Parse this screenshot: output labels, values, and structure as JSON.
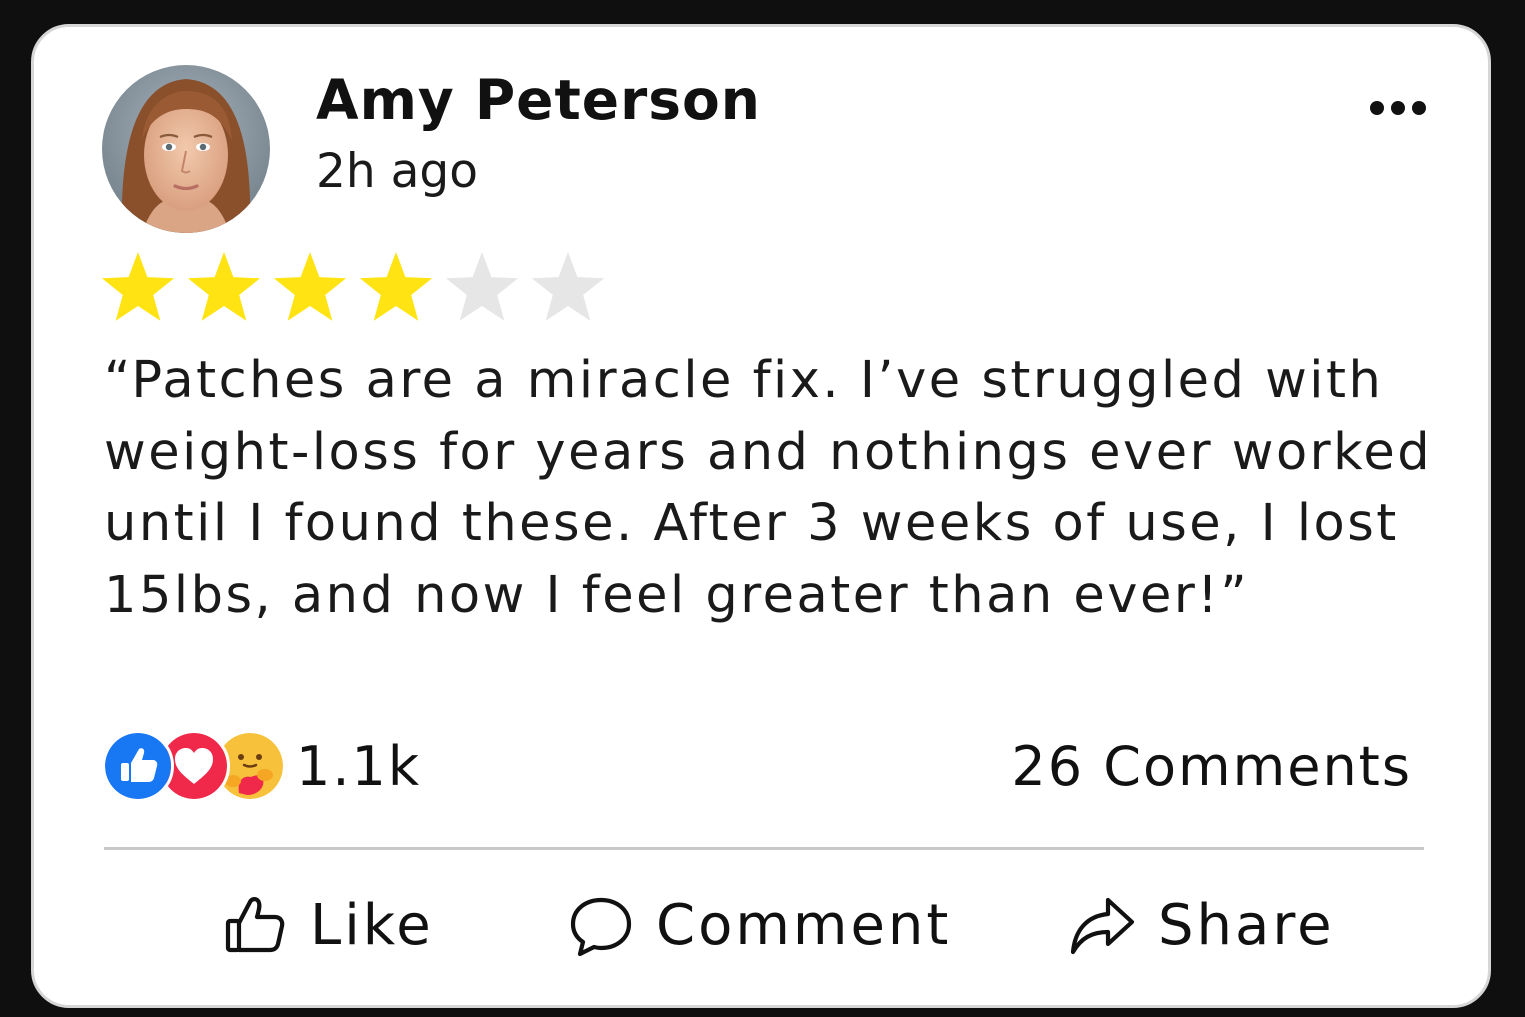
{
  "post": {
    "author_name": "Amy Peterson",
    "timestamp": "2h ago",
    "more_icon": "more-horizontal-icon",
    "rating": {
      "value": 4,
      "max": 6
    },
    "review_text": "“Patches are a miracle fix. I’ve struggled with weight-loss for years and nothings ever worked until I found these. After 3 weeks of use, I lost 15lbs, and now I feel greater than ever!”"
  },
  "engagement": {
    "reaction_icons": [
      "thumbs-up-icon",
      "heart-icon",
      "care-emoji-icon"
    ],
    "reaction_count": "1.1k",
    "comments_label": "26 Comments"
  },
  "actions": {
    "like_label": "Like",
    "comment_label": "Comment",
    "share_label": "Share"
  },
  "colors": {
    "star_filled": "#FFE312",
    "star_empty": "#E6E6E6",
    "like_blue": "#1877F2",
    "love_red": "#F02849",
    "emoji_yellow": "#F7C13B",
    "divider": "#C9C9C9"
  }
}
